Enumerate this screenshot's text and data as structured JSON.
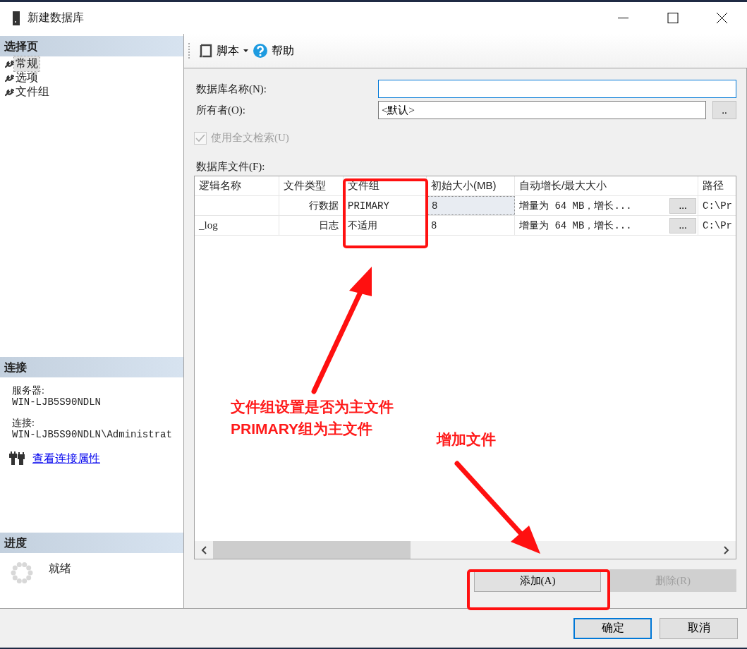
{
  "window": {
    "title": "新建数据库"
  },
  "select_page": {
    "header": "选择页",
    "items": [
      {
        "label": "常规",
        "selected": true
      },
      {
        "label": "选项",
        "selected": false
      },
      {
        "label": "文件组",
        "selected": false
      }
    ]
  },
  "connection": {
    "header": "连接",
    "server_label": "服务器:",
    "server": "WIN-LJB5S90NDLN",
    "connection_label": "连接:",
    "connection": "WIN-LJB5S90NDLN\\Administrat",
    "link": "查看连接属性"
  },
  "progress": {
    "header": "进度",
    "status": "就绪"
  },
  "toolbar": {
    "script": "脚本",
    "help": "帮助"
  },
  "form": {
    "name_label": "数据库名称(N):",
    "owner_label": "所有者(O):",
    "owner_value": "<默认>",
    "owner_browse": "..",
    "fulltext": {
      "label": "使用全文检索(U)",
      "checked": true,
      "disabled": true
    }
  },
  "files": {
    "label": "数据库文件(F):",
    "columns": [
      "逻辑名称",
      "文件类型",
      "文件组",
      "初始大小(MB)",
      "自动增长/最大大小",
      "路径"
    ],
    "rows": [
      {
        "type": "行数据",
        "filegroup": "PRIMARY",
        "size": "8",
        "growth": "增量为 64 MB，增长...",
        "growth_button": "...",
        "path": "C:\\Pr",
        "selected": true
      },
      {
        "logical_name": "_log",
        "type": "日志",
        "filegroup": "不适用",
        "size": "8",
        "growth": "增量为 64 MB，增长...",
        "growth_button": "...",
        "path": "C:\\Pr",
        "selected": false
      }
    ]
  },
  "file_buttons": [
    {
      "label": "添加(A)",
      "disabled": false
    },
    {
      "label": "删除(R)",
      "disabled": true
    }
  ],
  "footer_buttons": [
    {
      "label": "确定",
      "default": true
    },
    {
      "label": "取消",
      "default": false
    }
  ],
  "annotations": [
    {
      "text": "文件组设置是否为主文件"
    },
    {
      "text": "PRIMARY组为主文件"
    },
    {
      "text": "增加文件"
    }
  ]
}
